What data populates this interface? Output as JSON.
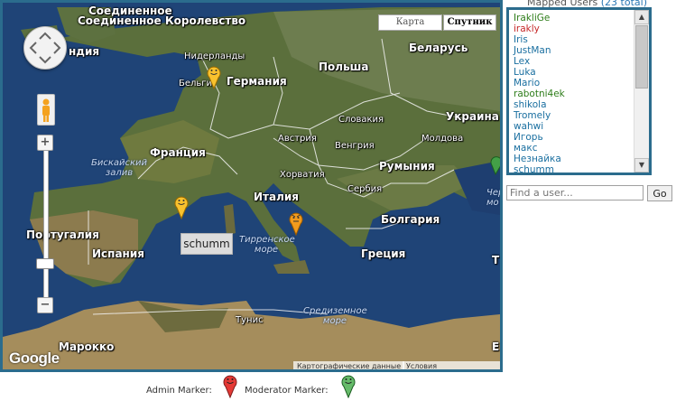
{
  "map": {
    "type_buttons": {
      "map": "Карта",
      "satellite": "Спутник"
    },
    "labels": {
      "uk": "Соединенное Королевство",
      "ireland": "ндия",
      "netherlands": "Нидерланды",
      "belgium": "Бельги",
      "germany": "Германия",
      "poland": "Польша",
      "belarus": "Беларусь",
      "slovakia": "Словакия",
      "ukraine": "Украина",
      "austria": "Австрия",
      "hungary": "Венгрия",
      "moldova": "Молдова",
      "france": "Франция",
      "biscay_bay": "Бискайский залив",
      "romania": "Румыния",
      "croatia": "Хорватия",
      "serbia": "Сербия",
      "italy": "Италия",
      "bulgaria": "Болгария",
      "portugal": "Португалия",
      "spain": "Испания",
      "tyrrhenian_sea": "Тирренское море",
      "greece": "Греция",
      "tunisia": "Тунис",
      "mediterranean": "Средиземное море",
      "morocco": "Марокко",
      "black_sea_partial": "Чер мо",
      "turkey_partial": "Т",
      "libya_partial": "Е"
    },
    "tooltip": "schumm",
    "logo": "Google",
    "map_data": "Картографические данные",
    "terms": "Условия использования"
  },
  "users": {
    "title": "Mapped Users",
    "count": "(23 total)",
    "list": [
      {
        "name": "IrakliGe",
        "color": "#2e7d1a"
      },
      {
        "name": "irakly",
        "color": "#c62828"
      },
      {
        "name": "Iris",
        "color": "#1a6fa0"
      },
      {
        "name": "JustMan",
        "color": "#1a6fa0"
      },
      {
        "name": "Lex",
        "color": "#1a6fa0"
      },
      {
        "name": "Luka",
        "color": "#1a6fa0"
      },
      {
        "name": "Mario",
        "color": "#1a6fa0"
      },
      {
        "name": "rabotni4ek",
        "color": "#2e7d1a"
      },
      {
        "name": "shikola",
        "color": "#1a6fa0"
      },
      {
        "name": "Tromely",
        "color": "#1a6fa0"
      },
      {
        "name": "wahwi",
        "color": "#1a6fa0"
      },
      {
        "name": "Игорь",
        "color": "#1a6fa0"
      },
      {
        "name": "макс",
        "color": "#1a6fa0"
      },
      {
        "name": "Незнайка",
        "color": "#1a6fa0"
      },
      {
        "name": "schumm",
        "color": "#1a6fa0"
      }
    ]
  },
  "search": {
    "placeholder": "Find a user...",
    "button": "Go"
  },
  "legend": {
    "admin": "Admin Marker:",
    "moderator": "Moderator Marker:"
  },
  "colors": {
    "frame": "#2b6c8d",
    "admin": "#e53935",
    "moderator": "#43a047",
    "user": "#f9c22e"
  }
}
